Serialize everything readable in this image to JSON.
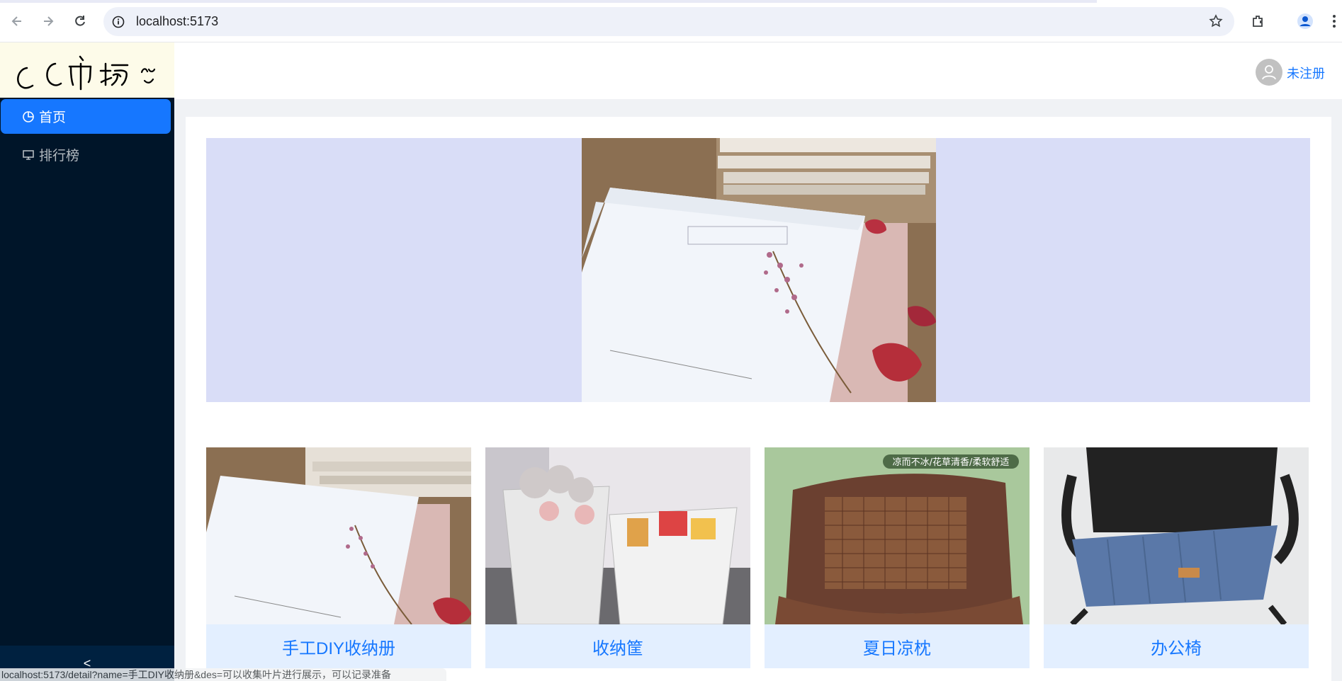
{
  "browser": {
    "url": "localhost:5173",
    "back_icon": "arrow-left-icon",
    "forward_icon": "arrow-right-icon",
    "reload_icon": "reload-icon",
    "status_url": "localhost:5173/detail?name=手工DIY收纳册&des=可以收集叶片进行展示，可以记录准备"
  },
  "sidebar": {
    "logo_text": "CC市场",
    "items": [
      {
        "label": "首页",
        "icon": "pie-chart-icon",
        "active": true
      },
      {
        "label": "排行榜",
        "icon": "desktop-icon",
        "active": false
      }
    ],
    "collapse_label": "<"
  },
  "header": {
    "register_label": "未注册",
    "avatar_icon": "user-icon"
  },
  "banner": {
    "image_desc": "album-with-flowers"
  },
  "products": [
    {
      "name": "手工DIY收纳册"
    },
    {
      "name": "收纳筐"
    },
    {
      "name": "夏日凉枕",
      "overlay_text": "凉而不冰/花草清香/柔软舒适"
    },
    {
      "name": "办公椅"
    }
  ],
  "colors": {
    "accent": "#1677ff",
    "sidebar_bg": "#001529",
    "banner_bg": "#d9ddf7",
    "card_bg": "#e3efff"
  }
}
